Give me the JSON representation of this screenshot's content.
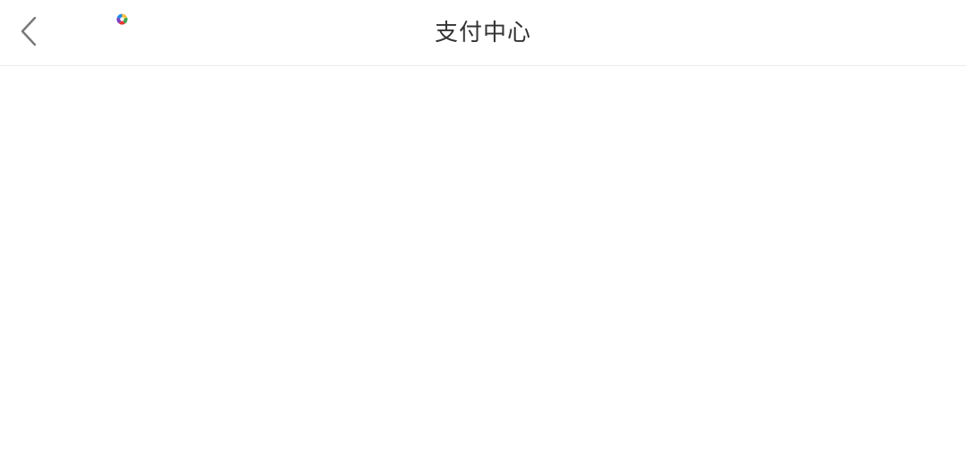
{
  "header": {
    "title": "支付中心",
    "back_icon": "chevron-left-icon",
    "loading_icon": "colorful-spinner-icon"
  },
  "colors": {
    "background": "#ffffff",
    "title": "#333333",
    "back_icon": "#777777",
    "divider": "#ececec"
  }
}
